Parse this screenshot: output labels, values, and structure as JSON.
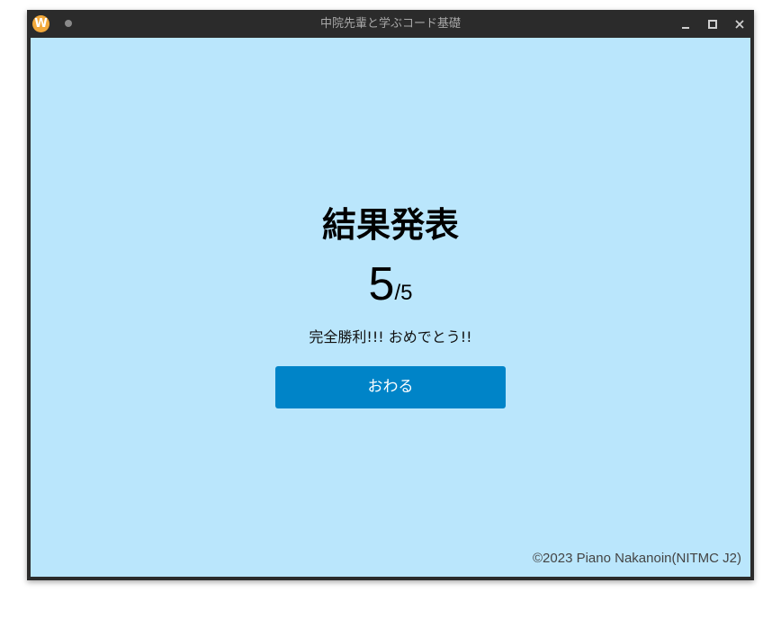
{
  "window": {
    "title": "中院先輩と学ぶコード基礎",
    "app_icon_letter": "W"
  },
  "result": {
    "heading": "結果発表",
    "score": "5",
    "total": "/5",
    "message": "完全勝利!!! おめでとう!!",
    "finish_button_label": "おわる"
  },
  "footer": {
    "copyright": "©2023 Piano Nakanoin(NITMC J2)"
  },
  "colors": {
    "background": "#bae6fc",
    "button": "#0084c8",
    "titlebar": "#2b2b2b",
    "app_icon": "#f2a93b"
  }
}
